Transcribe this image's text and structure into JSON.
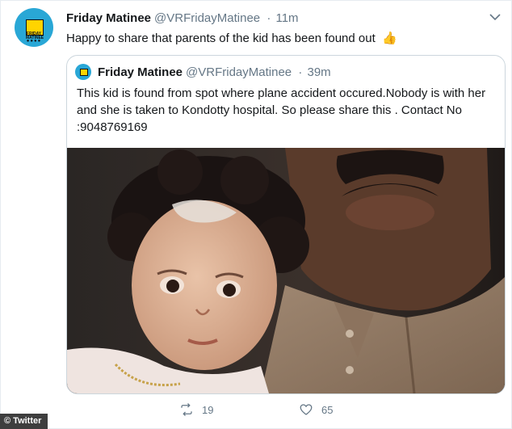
{
  "tweet": {
    "author_name": "Friday Matinee",
    "author_handle": "@VRFridayMatinee",
    "separator": "·",
    "time": "11m",
    "text": "Happy to share that parents of the kid has been found out",
    "emoji": "👍",
    "avatar_label": "FRIDAY MATINEE",
    "avatar_dots": "●●●●"
  },
  "quoted": {
    "author_name": "Friday Matinee",
    "author_handle": "@VRFridayMatinee",
    "separator": "·",
    "time": "39m",
    "text": "This kid is found from spot where plane accident occured.Nobody is with her and she is taken to Kondotty hospital. So please share this . Contact No :9048769169"
  },
  "actions": {
    "retweet_count": "19",
    "like_count": "65"
  },
  "credit": "© Twitter",
  "colors": {
    "accent": "#1da1f2",
    "muted": "#657786",
    "border": "#ccd6dd"
  }
}
